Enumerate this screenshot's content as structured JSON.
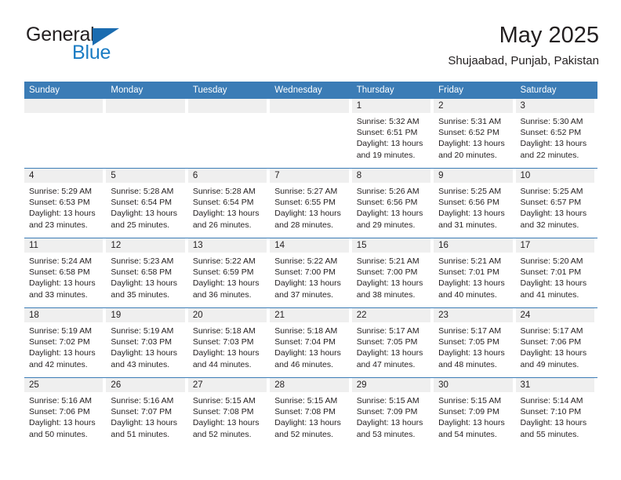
{
  "brand": {
    "word_one": "General",
    "word_two": "Blue",
    "triangle_icon": "blue-triangle-icon",
    "color_dark": "#231f20",
    "color_blue": "#1b7cc4"
  },
  "header": {
    "title": "May 2025",
    "subtitle": "Shujaabad, Punjab, Pakistan"
  },
  "theme": {
    "header_blue": "#3b7cb6",
    "daynum_gray": "#efefef",
    "text": "#231f20"
  },
  "weekdays": [
    "Sunday",
    "Monday",
    "Tuesday",
    "Wednesday",
    "Thursday",
    "Friday",
    "Saturday"
  ],
  "labels": {
    "sunrise": "Sunrise:",
    "sunset": "Sunset:",
    "daylight": "Daylight:"
  },
  "weeks": [
    [
      {
        "day": "",
        "sunrise": "",
        "sunset": "",
        "daylight_a": "",
        "daylight_b": ""
      },
      {
        "day": "",
        "sunrise": "",
        "sunset": "",
        "daylight_a": "",
        "daylight_b": ""
      },
      {
        "day": "",
        "sunrise": "",
        "sunset": "",
        "daylight_a": "",
        "daylight_b": ""
      },
      {
        "day": "",
        "sunrise": "",
        "sunset": "",
        "daylight_a": "",
        "daylight_b": ""
      },
      {
        "day": "1",
        "sunrise": "Sunrise: 5:32 AM",
        "sunset": "Sunset: 6:51 PM",
        "daylight_a": "Daylight: 13 hours",
        "daylight_b": "and 19 minutes."
      },
      {
        "day": "2",
        "sunrise": "Sunrise: 5:31 AM",
        "sunset": "Sunset: 6:52 PM",
        "daylight_a": "Daylight: 13 hours",
        "daylight_b": "and 20 minutes."
      },
      {
        "day": "3",
        "sunrise": "Sunrise: 5:30 AM",
        "sunset": "Sunset: 6:52 PM",
        "daylight_a": "Daylight: 13 hours",
        "daylight_b": "and 22 minutes."
      }
    ],
    [
      {
        "day": "4",
        "sunrise": "Sunrise: 5:29 AM",
        "sunset": "Sunset: 6:53 PM",
        "daylight_a": "Daylight: 13 hours",
        "daylight_b": "and 23 minutes."
      },
      {
        "day": "5",
        "sunrise": "Sunrise: 5:28 AM",
        "sunset": "Sunset: 6:54 PM",
        "daylight_a": "Daylight: 13 hours",
        "daylight_b": "and 25 minutes."
      },
      {
        "day": "6",
        "sunrise": "Sunrise: 5:28 AM",
        "sunset": "Sunset: 6:54 PM",
        "daylight_a": "Daylight: 13 hours",
        "daylight_b": "and 26 minutes."
      },
      {
        "day": "7",
        "sunrise": "Sunrise: 5:27 AM",
        "sunset": "Sunset: 6:55 PM",
        "daylight_a": "Daylight: 13 hours",
        "daylight_b": "and 28 minutes."
      },
      {
        "day": "8",
        "sunrise": "Sunrise: 5:26 AM",
        "sunset": "Sunset: 6:56 PM",
        "daylight_a": "Daylight: 13 hours",
        "daylight_b": "and 29 minutes."
      },
      {
        "day": "9",
        "sunrise": "Sunrise: 5:25 AM",
        "sunset": "Sunset: 6:56 PM",
        "daylight_a": "Daylight: 13 hours",
        "daylight_b": "and 31 minutes."
      },
      {
        "day": "10",
        "sunrise": "Sunrise: 5:25 AM",
        "sunset": "Sunset: 6:57 PM",
        "daylight_a": "Daylight: 13 hours",
        "daylight_b": "and 32 minutes."
      }
    ],
    [
      {
        "day": "11",
        "sunrise": "Sunrise: 5:24 AM",
        "sunset": "Sunset: 6:58 PM",
        "daylight_a": "Daylight: 13 hours",
        "daylight_b": "and 33 minutes."
      },
      {
        "day": "12",
        "sunrise": "Sunrise: 5:23 AM",
        "sunset": "Sunset: 6:58 PM",
        "daylight_a": "Daylight: 13 hours",
        "daylight_b": "and 35 minutes."
      },
      {
        "day": "13",
        "sunrise": "Sunrise: 5:22 AM",
        "sunset": "Sunset: 6:59 PM",
        "daylight_a": "Daylight: 13 hours",
        "daylight_b": "and 36 minutes."
      },
      {
        "day": "14",
        "sunrise": "Sunrise: 5:22 AM",
        "sunset": "Sunset: 7:00 PM",
        "daylight_a": "Daylight: 13 hours",
        "daylight_b": "and 37 minutes."
      },
      {
        "day": "15",
        "sunrise": "Sunrise: 5:21 AM",
        "sunset": "Sunset: 7:00 PM",
        "daylight_a": "Daylight: 13 hours",
        "daylight_b": "and 38 minutes."
      },
      {
        "day": "16",
        "sunrise": "Sunrise: 5:21 AM",
        "sunset": "Sunset: 7:01 PM",
        "daylight_a": "Daylight: 13 hours",
        "daylight_b": "and 40 minutes."
      },
      {
        "day": "17",
        "sunrise": "Sunrise: 5:20 AM",
        "sunset": "Sunset: 7:01 PM",
        "daylight_a": "Daylight: 13 hours",
        "daylight_b": "and 41 minutes."
      }
    ],
    [
      {
        "day": "18",
        "sunrise": "Sunrise: 5:19 AM",
        "sunset": "Sunset: 7:02 PM",
        "daylight_a": "Daylight: 13 hours",
        "daylight_b": "and 42 minutes."
      },
      {
        "day": "19",
        "sunrise": "Sunrise: 5:19 AM",
        "sunset": "Sunset: 7:03 PM",
        "daylight_a": "Daylight: 13 hours",
        "daylight_b": "and 43 minutes."
      },
      {
        "day": "20",
        "sunrise": "Sunrise: 5:18 AM",
        "sunset": "Sunset: 7:03 PM",
        "daylight_a": "Daylight: 13 hours",
        "daylight_b": "and 44 minutes."
      },
      {
        "day": "21",
        "sunrise": "Sunrise: 5:18 AM",
        "sunset": "Sunset: 7:04 PM",
        "daylight_a": "Daylight: 13 hours",
        "daylight_b": "and 46 minutes."
      },
      {
        "day": "22",
        "sunrise": "Sunrise: 5:17 AM",
        "sunset": "Sunset: 7:05 PM",
        "daylight_a": "Daylight: 13 hours",
        "daylight_b": "and 47 minutes."
      },
      {
        "day": "23",
        "sunrise": "Sunrise: 5:17 AM",
        "sunset": "Sunset: 7:05 PM",
        "daylight_a": "Daylight: 13 hours",
        "daylight_b": "and 48 minutes."
      },
      {
        "day": "24",
        "sunrise": "Sunrise: 5:17 AM",
        "sunset": "Sunset: 7:06 PM",
        "daylight_a": "Daylight: 13 hours",
        "daylight_b": "and 49 minutes."
      }
    ],
    [
      {
        "day": "25",
        "sunrise": "Sunrise: 5:16 AM",
        "sunset": "Sunset: 7:06 PM",
        "daylight_a": "Daylight: 13 hours",
        "daylight_b": "and 50 minutes."
      },
      {
        "day": "26",
        "sunrise": "Sunrise: 5:16 AM",
        "sunset": "Sunset: 7:07 PM",
        "daylight_a": "Daylight: 13 hours",
        "daylight_b": "and 51 minutes."
      },
      {
        "day": "27",
        "sunrise": "Sunrise: 5:15 AM",
        "sunset": "Sunset: 7:08 PM",
        "daylight_a": "Daylight: 13 hours",
        "daylight_b": "and 52 minutes."
      },
      {
        "day": "28",
        "sunrise": "Sunrise: 5:15 AM",
        "sunset": "Sunset: 7:08 PM",
        "daylight_a": "Daylight: 13 hours",
        "daylight_b": "and 52 minutes."
      },
      {
        "day": "29",
        "sunrise": "Sunrise: 5:15 AM",
        "sunset": "Sunset: 7:09 PM",
        "daylight_a": "Daylight: 13 hours",
        "daylight_b": "and 53 minutes."
      },
      {
        "day": "30",
        "sunrise": "Sunrise: 5:15 AM",
        "sunset": "Sunset: 7:09 PM",
        "daylight_a": "Daylight: 13 hours",
        "daylight_b": "and 54 minutes."
      },
      {
        "day": "31",
        "sunrise": "Sunrise: 5:14 AM",
        "sunset": "Sunset: 7:10 PM",
        "daylight_a": "Daylight: 13 hours",
        "daylight_b": "and 55 minutes."
      }
    ]
  ]
}
